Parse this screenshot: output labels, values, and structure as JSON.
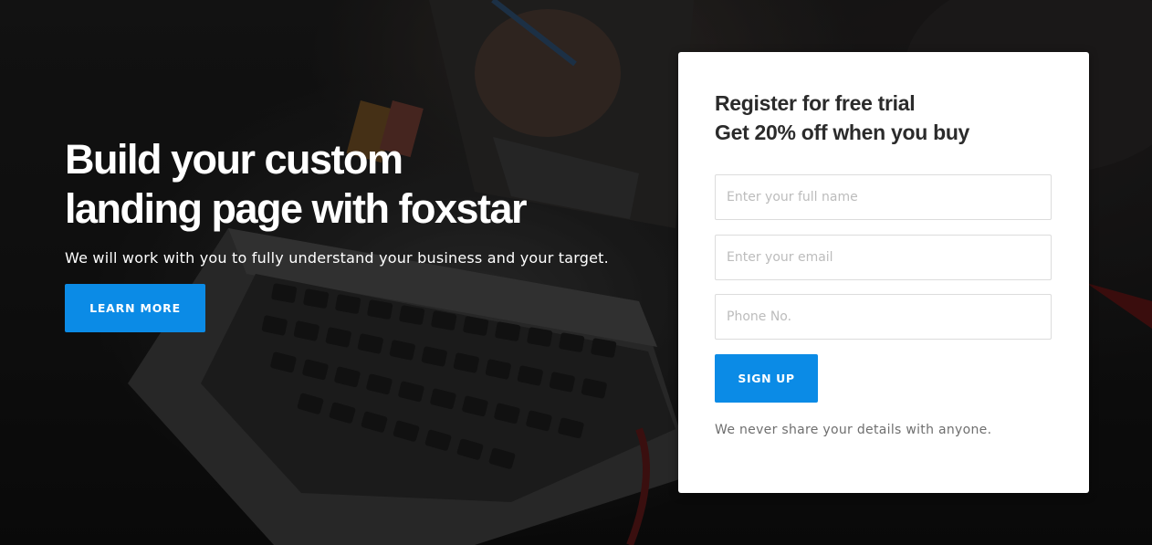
{
  "hero": {
    "headline_line1": "Build your custom",
    "headline_line2": "landing page with foxstar",
    "subtext": "We will work with you to fully understand your business and your target.",
    "learn_more_label": "LEARN MORE"
  },
  "signup_form": {
    "title_line1": "Register for free trial",
    "title_line2": "Get 20% off when you buy",
    "name_placeholder": "Enter your full name",
    "name_value": "",
    "email_placeholder": "Enter your email",
    "email_value": "",
    "phone_placeholder": "Phone No.",
    "phone_value": "",
    "submit_label": "SIGN UP",
    "privacy_note": "We never share your details with anyone."
  },
  "colors": {
    "accent": "#0b8be6",
    "card_background": "#ffffff",
    "headline_text": "#ffffff",
    "card_title_text": "#2b2b2b",
    "muted_text": "#6f6f6f"
  }
}
